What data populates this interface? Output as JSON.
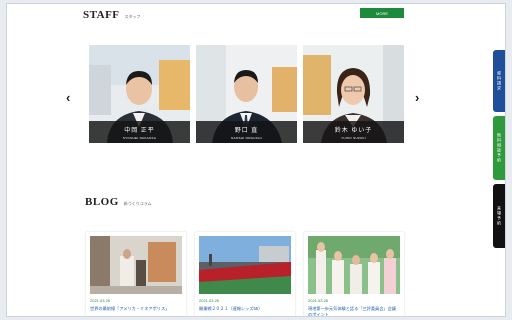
{
  "staff_section": {
    "title_en": "STAFF",
    "title_jp": "スタッフ",
    "more_label": "MORE",
    "prev_arrow": "‹",
    "next_arrow": "›",
    "members": [
      {
        "name": "中岡 正平",
        "romaji": "SYOUHEI NAKAOKA"
      },
      {
        "name": "野口 直",
        "romaji": "NAOSHI NOGUCHI"
      },
      {
        "name": "鈴木 ゆい子",
        "romaji": "YUIKO SUZUKI"
      }
    ]
  },
  "blog_section": {
    "title_en": "BLOG",
    "title_jp": "新づくりコラム",
    "posts": [
      {
        "date": "2021.03.26",
        "title": "世界の最前線「アメリカ・ミネアポリス」"
      },
      {
        "date": "2021.03.26",
        "title": "開業戦２０２１（速報レッズ55）"
      },
      {
        "date": "2021.03.26",
        "title": "現地第一歩元気体験と話る「三評委員会」会議のポイント"
      }
    ]
  },
  "side_tabs": [
    {
      "label": "資料請求",
      "color": "#1f4e9a"
    },
    {
      "label": "無料相談予約",
      "color": "#2e9a3b"
    },
    {
      "label": "来場予約",
      "color": "#111111"
    }
  ],
  "colors": {
    "accent_green": "#1e8a3c",
    "link_blue": "#2060a8"
  }
}
